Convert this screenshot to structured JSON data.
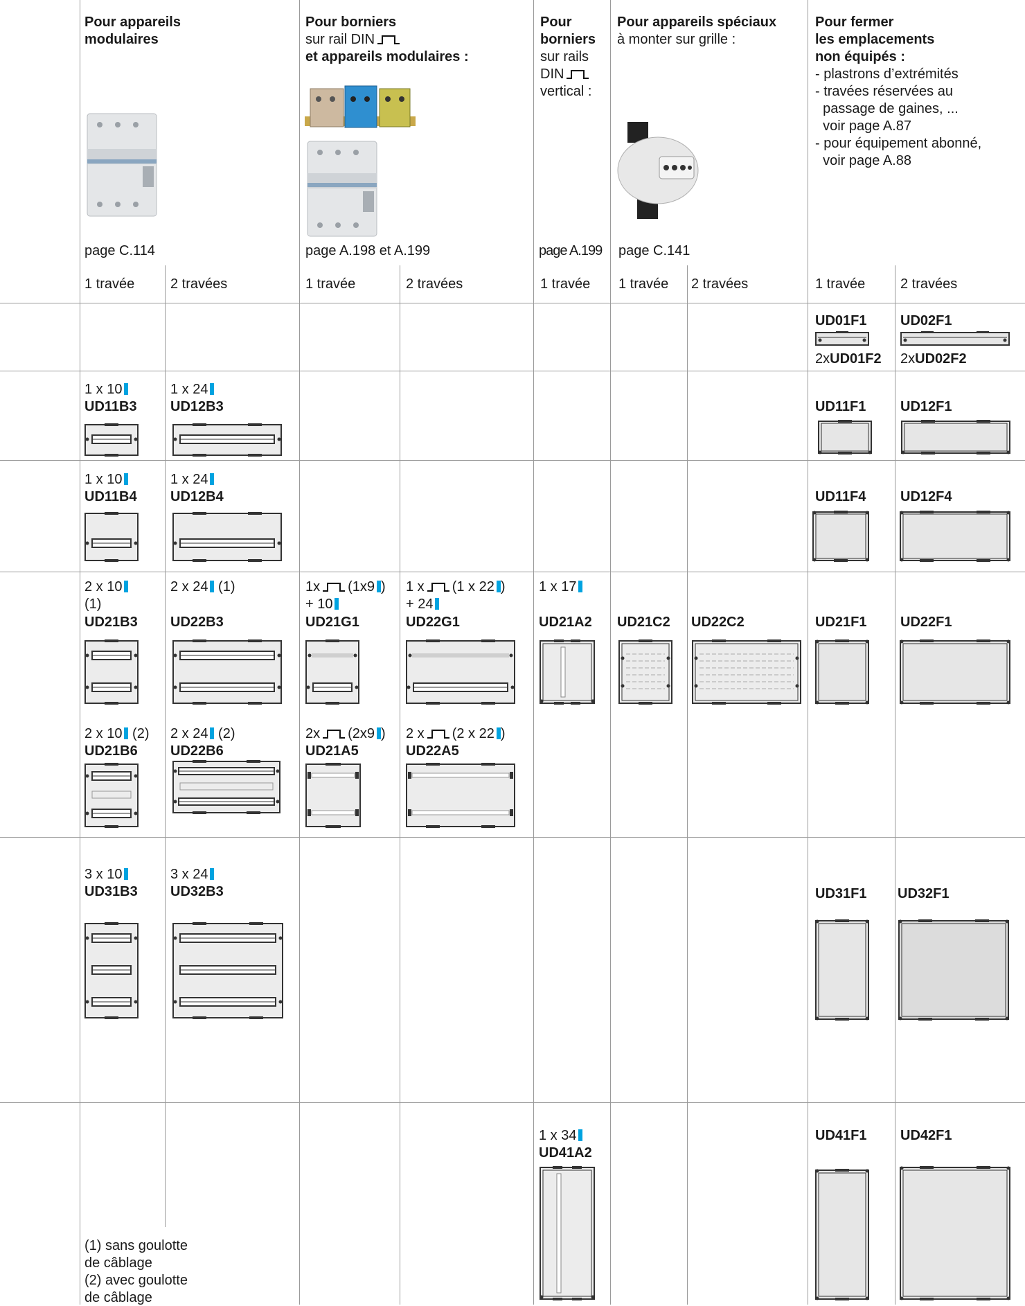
{
  "headers": {
    "modulaires": {
      "title": "Pour appareils modulaires",
      "line1": "Pour appareils",
      "line2": "modulaires",
      "page": "page C.114"
    },
    "borniers_modulaires": {
      "line1": "Pour borniers",
      "line2": "sur rail DIN",
      "line3": "et appareils modulaires :",
      "page": "page A.198 et A.199"
    },
    "borniers_vertical": {
      "line1": "Pour",
      "line2": "borniers",
      "line3": "sur rails",
      "line4": "DIN",
      "line5": "vertical :",
      "page": "page A.199"
    },
    "speciaux": {
      "line1": "Pour appareils spéciaux",
      "line2": "à monter sur grille :",
      "page": "page C.141"
    },
    "fermer": {
      "line1": "Pour fermer",
      "line2": "les emplacements",
      "line3": "non équipés :",
      "items": [
        "- plastrons d’extrémités",
        "- travées réservées au",
        "  passage de gaines, ...",
        "  voir page A.87",
        "- pour équipement abonné,",
        "  voir page A.88"
      ]
    }
  },
  "col_labels": {
    "c1": "1 travée",
    "c2": "2 travées",
    "c3": "1 travée",
    "c4": "2 travées",
    "c5": "1 travée",
    "c6": "1 travée",
    "c7": "2 travées",
    "c8": "1 travée",
    "c9": "2 travées"
  },
  "row1": {
    "ud01f1": "UD01F1",
    "ud02f1": "UD02F1",
    "ud01f2_prefix": "2x",
    "ud01f2": "UD01F2",
    "ud02f2_prefix": "2x",
    "ud02f2": "UD02F2"
  },
  "row2": {
    "q1": "1 x 10",
    "ud11b3": "UD11B3",
    "q2": "1 x 24",
    "ud12b3": "UD12B3",
    "ud11f1": "UD11F1",
    "ud12f1": "UD12F1"
  },
  "row3": {
    "q1": "1 x 10",
    "ud11b4": "UD11B4",
    "q2": "1 x 24",
    "ud12b4": "UD12B4",
    "ud11f4": "UD11F4",
    "ud12f4": "UD12F4"
  },
  "row4": {
    "q1": "2 x 10",
    "q1b": "(1)",
    "ud21b3": "UD21B3",
    "q2": "2 x 24",
    "q2b": "(1)",
    "ud22b3": "UD22B3",
    "q3a": "1x",
    "q3b": "(1x9",
    "q3c": ")",
    "q3d": "+ 10",
    "ud21g1": "UD21G1",
    "q4a": "1 x",
    "q4b": "(1 x 22",
    "q4c": ")",
    "q4d": "+ 24",
    "ud22g1": "UD22G1",
    "q5": "1 x 17",
    "ud21a2": "UD21A2",
    "ud21c2": "UD21C2",
    "ud22c2": "UD22C2",
    "ud21f1": "UD21F1",
    "ud22f1": "UD22F1",
    "q6": "2 x 10",
    "q6b": "(2)",
    "ud21b6": "UD21B6",
    "q7": "2 x 24",
    "q7b": "(2)",
    "ud22b6": "UD22B6",
    "q8a": "2x",
    "q8b": "(2x9",
    "q8c": ")",
    "ud21a5": "UD21A5",
    "q9a": "2 x",
    "q9b": "(2 x 22",
    "q9c": ")",
    "ud22a5": "UD22A5"
  },
  "row5": {
    "q1": "3 x 10",
    "ud31b3": "UD31B3",
    "q2": "3 x 24",
    "ud32b3": "UD32B3",
    "ud31f1": "UD31F1",
    "ud32f1": "UD32F1"
  },
  "row6": {
    "q1": "1 x 34",
    "ud41a2": "UD41A2",
    "ud41f1": "UD41F1",
    "ud42f1": "UD42F1",
    "notes": [
      "(1) sans goulotte",
      "de câblage",
      "(2) avec goulotte",
      "de câblage"
    ]
  },
  "colors": {
    "accent": "#00a3e0",
    "grid": "#9a9a9a",
    "panel": "#e6e6e6"
  }
}
